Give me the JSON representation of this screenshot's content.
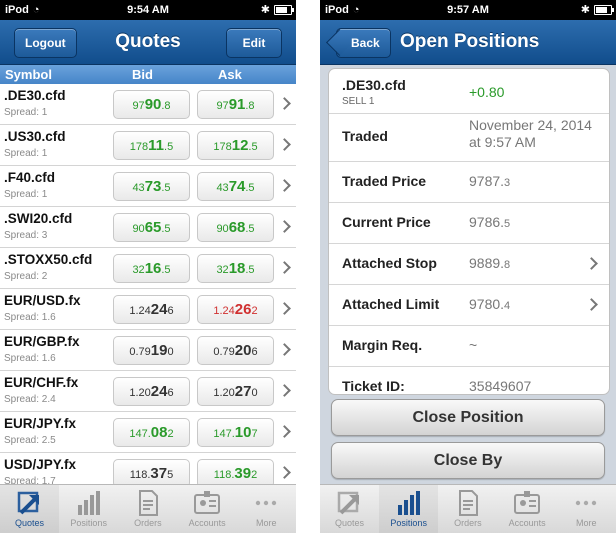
{
  "left_screen": {
    "status": {
      "carrier": "iPod",
      "time": "9:54 AM"
    },
    "nav": {
      "title": "Quotes",
      "logout_label": "Logout",
      "edit_label": "Edit"
    },
    "columns": {
      "symbol": "Symbol",
      "bid": "Bid",
      "ask": "Ask"
    },
    "quotes": [
      {
        "symbol": ".DE30.cfd",
        "spread": "Spread: 1",
        "bid": {
          "pre": "97",
          "big": "90",
          "post": ".8",
          "color": "green"
        },
        "ask": {
          "pre": "97",
          "big": "91",
          "post": ".8",
          "color": "green"
        }
      },
      {
        "symbol": ".US30.cfd",
        "spread": "Spread: 1",
        "bid": {
          "pre": "178",
          "big": "11",
          "post": ".5",
          "color": "green"
        },
        "ask": {
          "pre": "178",
          "big": "12",
          "post": ".5",
          "color": "green"
        }
      },
      {
        "symbol": ".F40.cfd",
        "spread": "Spread: 1",
        "bid": {
          "pre": "43",
          "big": "73",
          "post": ".5",
          "color": "green"
        },
        "ask": {
          "pre": "43",
          "big": "74",
          "post": ".5",
          "color": "green"
        }
      },
      {
        "symbol": ".SWI20.cfd",
        "spread": "Spread: 3",
        "bid": {
          "pre": "90",
          "big": "65",
          "post": ".5",
          "color": "green"
        },
        "ask": {
          "pre": "90",
          "big": "68",
          "post": ".5",
          "color": "green"
        }
      },
      {
        "symbol": ".STOXX50.cfd",
        "spread": "Spread: 2",
        "bid": {
          "pre": "32",
          "big": "16",
          "post": ".5",
          "color": "green"
        },
        "ask": {
          "pre": "32",
          "big": "18",
          "post": ".5",
          "color": "green"
        }
      },
      {
        "symbol": "EUR/USD.fx",
        "spread": "Spread: 1.6",
        "bid": {
          "pre": "1.24",
          "big": "24",
          "post": "6",
          "color": "neutral"
        },
        "ask": {
          "pre": "1.24",
          "big": "26",
          "post": "2",
          "color": "red"
        }
      },
      {
        "symbol": "EUR/GBP.fx",
        "spread": "Spread: 1.6",
        "bid": {
          "pre": "0.79",
          "big": "19",
          "post": "0",
          "color": "neutral"
        },
        "ask": {
          "pre": "0.79",
          "big": "20",
          "post": "6",
          "color": "neutral"
        }
      },
      {
        "symbol": "EUR/CHF.fx",
        "spread": "Spread: 2.4",
        "bid": {
          "pre": "1.20",
          "big": "24",
          "post": "6",
          "color": "neutral"
        },
        "ask": {
          "pre": "1.20",
          "big": "27",
          "post": "0",
          "color": "neutral"
        }
      },
      {
        "symbol": "EUR/JPY.fx",
        "spread": "Spread: 2.5",
        "bid": {
          "pre": "147.",
          "big": "08",
          "post": "2",
          "color": "green"
        },
        "ask": {
          "pre": "147.",
          "big": "10",
          "post": "7",
          "color": "green"
        }
      },
      {
        "symbol": "USD/JPY.fx",
        "spread": "Spread: 1.7",
        "bid": {
          "pre": "118.",
          "big": "37",
          "post": "5",
          "color": "neutral"
        },
        "ask": {
          "pre": "118.",
          "big": "39",
          "post": "2",
          "color": "green"
        }
      }
    ],
    "tabs": [
      {
        "label": "Quotes",
        "icon": "quotes-arrow-icon",
        "active": true
      },
      {
        "label": "Positions",
        "icon": "positions-bars-icon",
        "active": false
      },
      {
        "label": "Orders",
        "icon": "orders-document-icon",
        "active": false
      },
      {
        "label": "Accounts",
        "icon": "accounts-card-icon",
        "active": false
      },
      {
        "label": "More",
        "icon": "more-dots-icon",
        "active": false
      }
    ]
  },
  "right_screen": {
    "status": {
      "carrier": "iPod",
      "time": "9:57 AM"
    },
    "nav": {
      "title": "Open Positions",
      "back_label": "Back"
    },
    "position": {
      "symbol": ".DE30.cfd",
      "side": "SELL 1",
      "pnl": "+0.80",
      "rows": [
        {
          "label": "Traded",
          "value": "November 24, 2014 at 9:57 AM",
          "chevron": false
        },
        {
          "label": "Traded Price",
          "value_main": "9787.",
          "value_small": "3",
          "chevron": false
        },
        {
          "label": "Current Price",
          "value_main": "9786.",
          "value_small": "5",
          "chevron": false
        },
        {
          "label": "Attached Stop",
          "value_main": "9889.",
          "value_small": "8",
          "chevron": true
        },
        {
          "label": "Attached Limit",
          "value_main": "9780.",
          "value_small": "4",
          "chevron": true
        },
        {
          "label": "Margin Req.",
          "value": "~",
          "chevron": false
        },
        {
          "label": "Ticket ID:",
          "value": "35849607",
          "chevron": false
        }
      ]
    },
    "buttons": {
      "close_position": "Close Position",
      "close_by": "Close By"
    },
    "tabs": [
      {
        "label": "Quotes",
        "icon": "quotes-arrow-icon",
        "active": false
      },
      {
        "label": "Positions",
        "icon": "positions-bars-icon",
        "active": true
      },
      {
        "label": "Orders",
        "icon": "orders-document-icon",
        "active": false
      },
      {
        "label": "Accounts",
        "icon": "accounts-card-icon",
        "active": false
      },
      {
        "label": "More",
        "icon": "more-dots-icon",
        "active": false
      }
    ]
  },
  "colors": {
    "nav_blue": "#1d5a99",
    "header_blue": "#4685c8",
    "green": "#2a9a2a",
    "red": "#d03030"
  }
}
